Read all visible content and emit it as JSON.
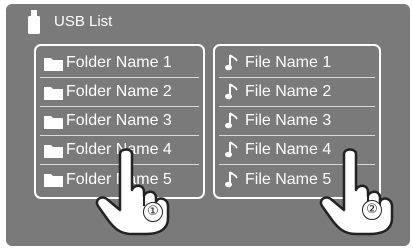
{
  "header": {
    "title": "USB List",
    "icon": "usb-stick-icon"
  },
  "folders": [
    {
      "label": "Folder Name 1",
      "icon": "folder-icon"
    },
    {
      "label": "Folder Name 2",
      "icon": "folder-icon"
    },
    {
      "label": "Folder Name 3",
      "icon": "folder-icon"
    },
    {
      "label": "Folder Name 4",
      "icon": "folder-icon"
    },
    {
      "label": "Folder Name 5",
      "icon": "folder-icon"
    }
  ],
  "files": [
    {
      "label": "File Name 1",
      "icon": "music-note-icon"
    },
    {
      "label": "File Name 2",
      "icon": "music-note-icon"
    },
    {
      "label": "File Name 3",
      "icon": "music-note-icon"
    },
    {
      "label": "File Name 4",
      "icon": "music-note-icon"
    },
    {
      "label": "File Name 5",
      "icon": "music-note-icon"
    }
  ],
  "callouts": {
    "first": "①",
    "second": "②"
  },
  "colors": {
    "screen_bg": "#7a7a7a",
    "text": "#ffffff",
    "border": "#ffffff"
  }
}
